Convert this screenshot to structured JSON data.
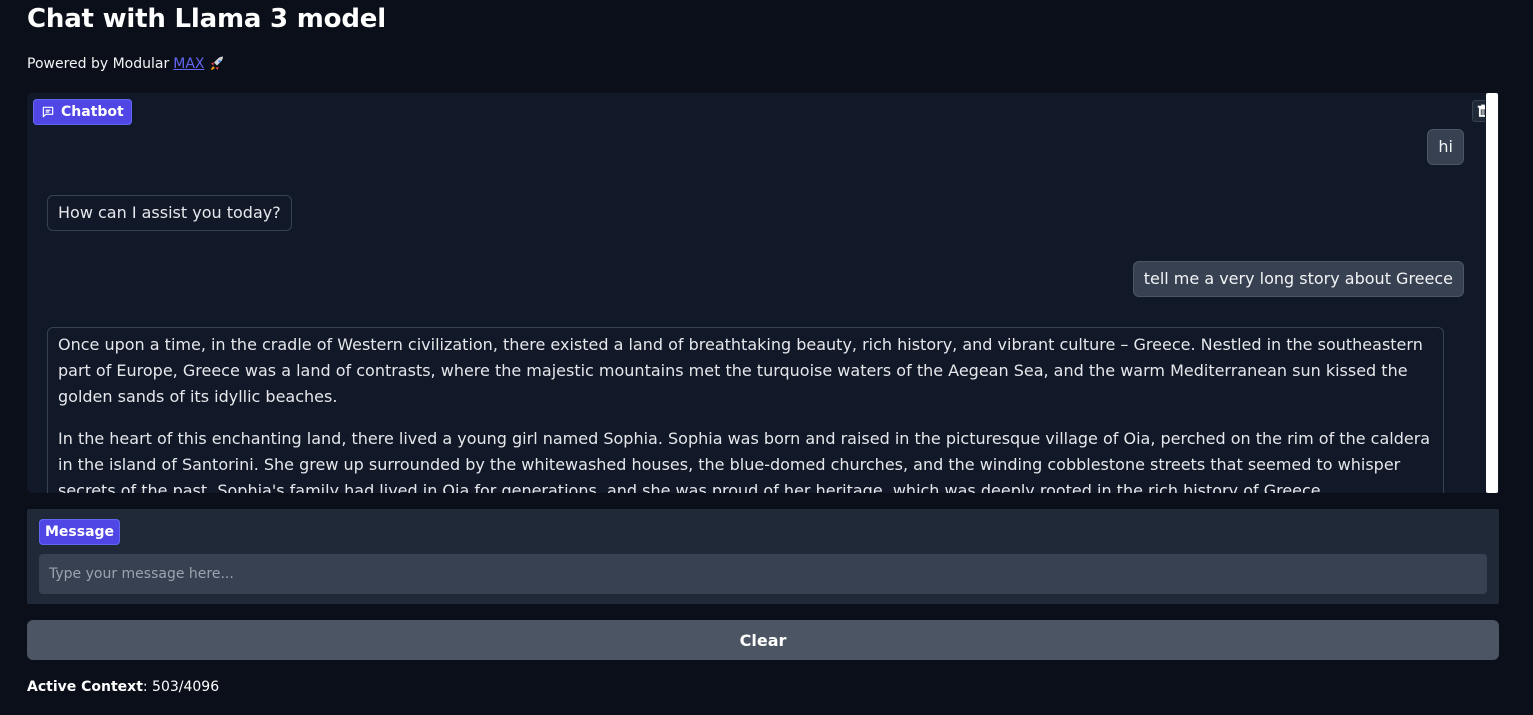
{
  "page": {
    "title": "Chat with Llama 3 model",
    "subtitle_prefix": "Powered by Modular",
    "subtitle_link": "MAX"
  },
  "chatbot": {
    "label": "Chatbot",
    "messages": [
      {
        "role": "user",
        "text": "hi"
      },
      {
        "role": "assistant",
        "text": "How can I assist you today?"
      },
      {
        "role": "user",
        "text": "tell me a very long story about Greece"
      },
      {
        "role": "assistant",
        "paragraphs": [
          "Once upon a time, in the cradle of Western civilization, there existed a land of breathtaking beauty, rich history, and vibrant culture – Greece. Nestled in the southeastern part of Europe, Greece was a land of contrasts, where the majestic mountains met the turquoise waters of the Aegean Sea, and the warm Mediterranean sun kissed the golden sands of its idyllic beaches.",
          "In the heart of this enchanting land, there lived a young girl named Sophia. Sophia was born and raised in the picturesque village of Oia, perched on the rim of the caldera in the island of Santorini. She grew up surrounded by the whitewashed houses, the blue-domed churches, and the winding cobblestone streets that seemed to whisper secrets of the past. Sophia's family had lived in Oia for generations, and she was proud of her heritage, which was deeply rooted in the rich history of Greece."
        ]
      }
    ]
  },
  "message": {
    "label": "Message",
    "placeholder": "Type your message here..."
  },
  "actions": {
    "clear_label": "Clear"
  },
  "status": {
    "context_label": "Active Context",
    "context_value": ": 503/4096"
  },
  "icons": {
    "chat": "chat-bubble-icon",
    "delete": "trash-icon",
    "rocket": "rocket-icon"
  },
  "colors": {
    "accent": "#4f46e5",
    "link": "#6366f1",
    "background": "#0b0f19",
    "panel": "#111827",
    "input_panel": "#1f2937",
    "button": "#4b5563"
  }
}
